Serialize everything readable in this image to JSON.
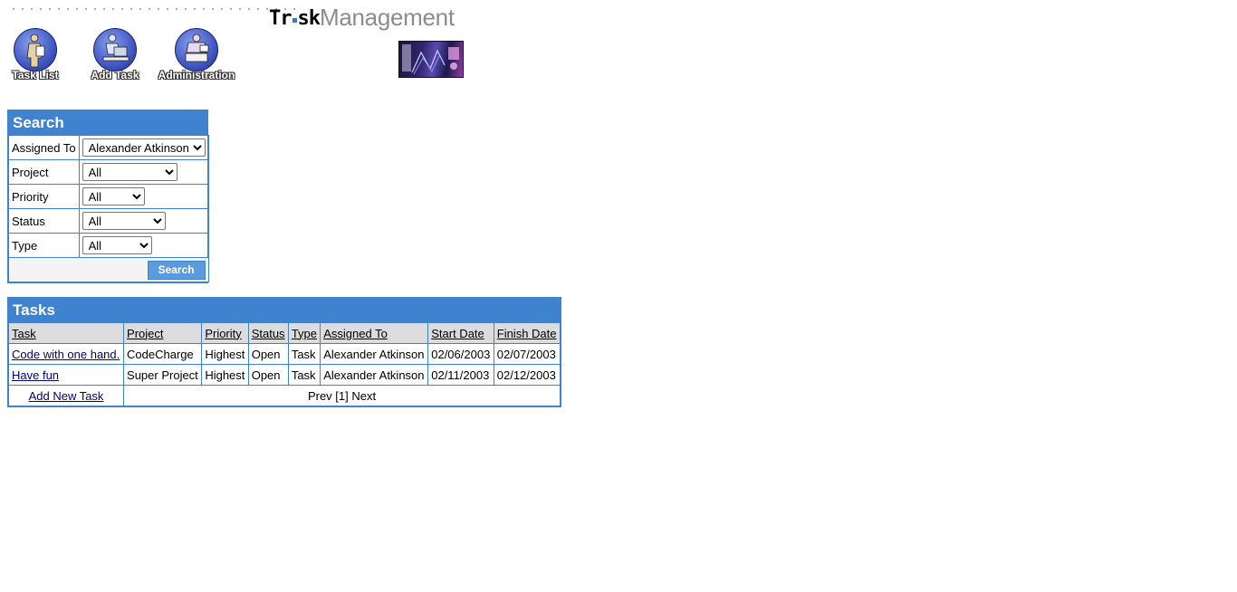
{
  "header": {
    "logo_word1_a": "Tr",
    "logo_word1_b": "sk",
    "logo_word2": "Management"
  },
  "nav": {
    "items": [
      {
        "label": "Task List",
        "icon": "task-list-icon"
      },
      {
        "label": "Add Task",
        "icon": "add-task-icon"
      },
      {
        "label": "Administration",
        "icon": "administration-icon"
      }
    ]
  },
  "search": {
    "title": "Search",
    "fields": [
      {
        "label": "Assigned To",
        "value": "Alexander Atkinson"
      },
      {
        "label": "Project",
        "value": "All"
      },
      {
        "label": "Priority",
        "value": "All"
      },
      {
        "label": "Status",
        "value": "All"
      },
      {
        "label": "Type",
        "value": "All"
      }
    ],
    "button_label": "Search"
  },
  "tasks": {
    "title": "Tasks",
    "columns": [
      "Task",
      "Project",
      "Priority",
      "Status",
      "Type",
      "Assigned To",
      "Start Date",
      "Finish Date"
    ],
    "rows": [
      [
        "Code with one hand.",
        "CodeCharge",
        "Highest",
        "Open",
        "Task",
        "Alexander Atkinson",
        "02/06/2003",
        "02/07/2003"
      ],
      [
        "Have fun",
        "Super Project",
        "Highest",
        "Open",
        "Task",
        "Alexander Atkinson",
        "02/11/2003",
        "02/12/2003"
      ]
    ],
    "add_link": "Add New Task",
    "pager": "Prev [1] Next"
  },
  "colors": {
    "accent": "#3f83cf",
    "button": "#5b9bdc",
    "header_row": "#dcdcdc",
    "link": "#000080"
  }
}
